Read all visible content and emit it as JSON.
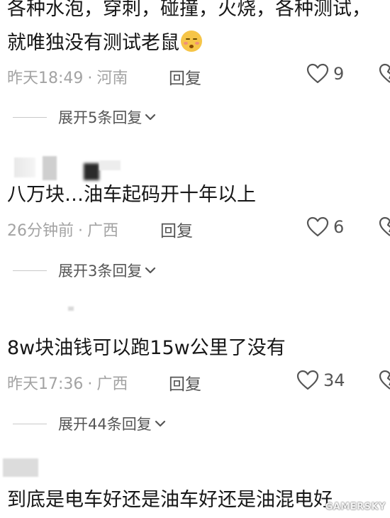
{
  "comments": [
    {
      "text_line1": "各种水泡，穿刺，碰撞，火烧，各种测试，",
      "text_line2": "就唯独没有测试老鼠",
      "emoji": "sleepy-face-emoji",
      "time": "昨天18:49",
      "separator": "·",
      "location": "河南",
      "reply_label": "回复",
      "likes": "9",
      "expand_label": "展开5条回复"
    },
    {
      "text": "八万块…油车起码开十年以上",
      "time": "26分钟前",
      "separator": "·",
      "location": "广西",
      "reply_label": "回复",
      "likes": "6",
      "expand_label": "展开3条回复"
    },
    {
      "text": "8w块油钱可以跑15w公里了没有",
      "time": "昨天17:36",
      "separator": "·",
      "location": "广西",
      "reply_label": "回复",
      "likes": "34",
      "expand_label": "展开44条回复"
    },
    {
      "text": "到底是电车好还是油车好还是油混电好"
    }
  ],
  "icons": {
    "like": "heart-outline-icon",
    "dislike": "broken-heart-icon",
    "expand": "chevron-down-icon"
  },
  "colors": {
    "text": "#161616",
    "meta": "#a3a3a3",
    "action": "#555555"
  },
  "watermark": "GAMERSKY"
}
